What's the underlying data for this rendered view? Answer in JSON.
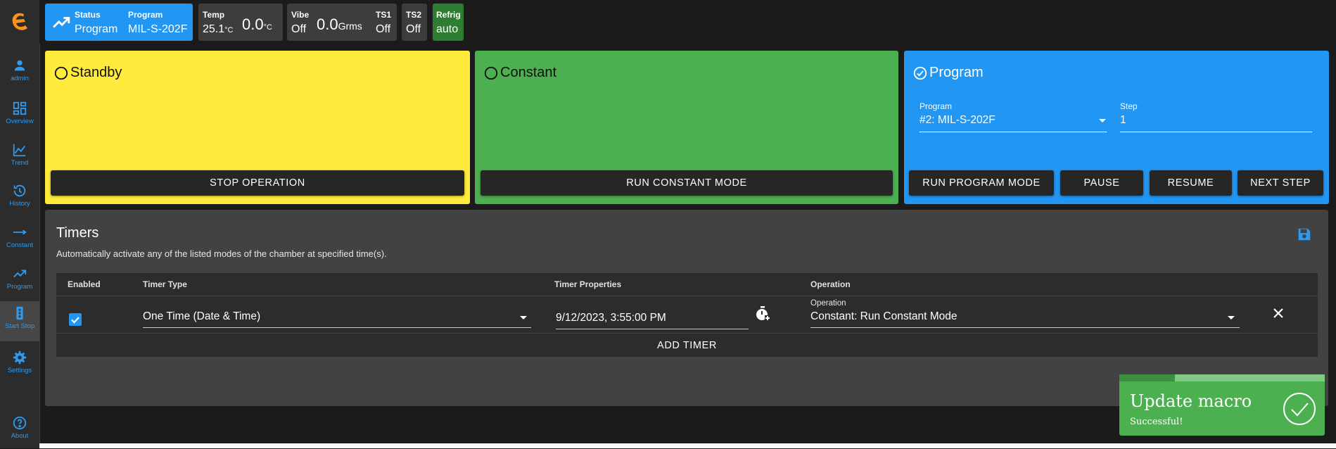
{
  "sidebar": {
    "items": [
      {
        "label": "admin",
        "icon": "person-icon"
      },
      {
        "label": "Overview",
        "icon": "dashboard-icon"
      },
      {
        "label": "Trend",
        "icon": "trend-chart-icon"
      },
      {
        "label": "History",
        "icon": "history-icon"
      },
      {
        "label": "Constant",
        "icon": "arrow-right-icon"
      },
      {
        "label": "Program",
        "icon": "trending-up-icon"
      },
      {
        "label": "Start Stop",
        "icon": "traffic-light-icon"
      },
      {
        "label": "Settings",
        "icon": "gear-icon"
      },
      {
        "label": "About",
        "icon": "help-icon"
      }
    ],
    "active": "Start Stop"
  },
  "status": {
    "status_label": "Status",
    "status_value": "Program",
    "program_label": "Program",
    "program_value": "MIL-S-202F",
    "temp_label": "Temp",
    "temp_value": "25.1",
    "temp_unit": "°C",
    "temp_set": "0.0",
    "temp_set_unit": "°C",
    "vibe_label": "Vibe",
    "vibe_value": "Off",
    "vibe_set": "0.0",
    "vibe_unit": "Grms",
    "ts1_label": "TS1",
    "ts1_value": "Off",
    "ts2_label": "TS2",
    "ts2_value": "Off",
    "refrig_label": "Refrig",
    "refrig_value": "auto"
  },
  "modes": {
    "standby": {
      "title": "Standby",
      "button": "STOP OPERATION",
      "color": "#ffeb3b"
    },
    "constant": {
      "title": "Constant",
      "button": "RUN CONSTANT MODE",
      "color": "#4caf50"
    },
    "program": {
      "title": "Program",
      "color": "#2196f3",
      "program_label": "Program",
      "program_value": "#2: MIL-S-202F",
      "step_label": "Step",
      "step_value": "1",
      "buttons": [
        "RUN PROGRAM MODE",
        "PAUSE",
        "RESUME",
        "NEXT STEP"
      ]
    }
  },
  "timers": {
    "title": "Timers",
    "description": "Automatically activate any of the listed modes of the chamber at specified time(s).",
    "columns": [
      "Enabled",
      "Timer Type",
      "Timer Properties",
      "Operation"
    ],
    "rows": [
      {
        "enabled": true,
        "timer_type": "One Time (Date & Time)",
        "properties": "9/12/2023, 3:55:00 PM",
        "operation_label": "Operation",
        "operation": "Constant: Run Constant Mode"
      }
    ],
    "add_label": "ADD TIMER"
  },
  "toast": {
    "title": "Update macro",
    "message": "Successful!",
    "progress": 0.27
  },
  "colors": {
    "accent": "#2196f3",
    "yellow": "#ffeb3b",
    "green": "#4caf50",
    "dark_green": "#2e7d32"
  }
}
